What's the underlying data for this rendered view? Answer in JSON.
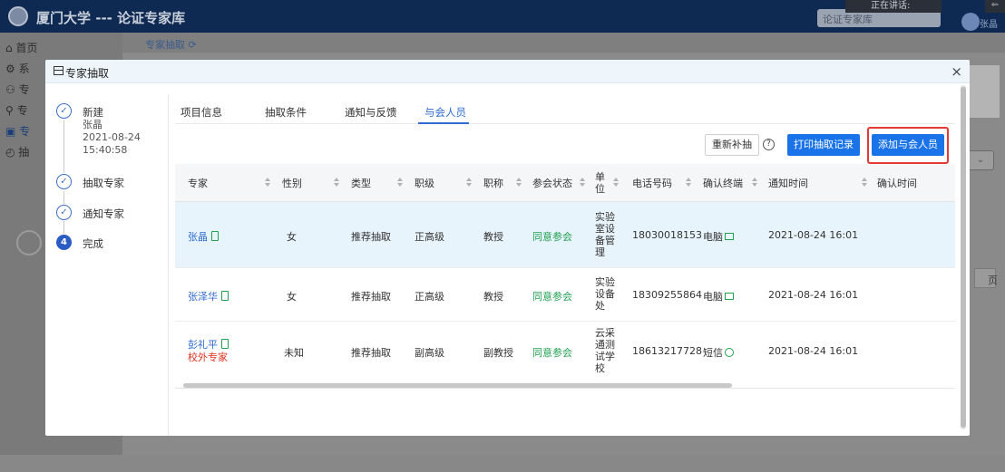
{
  "app": {
    "title": "厦门大学 --- 论证专家库",
    "library_select": "论证专家库",
    "speaking": "正在讲话:",
    "user": "张晶"
  },
  "sidebar": {
    "items": [
      {
        "label": "首页"
      },
      {
        "label": "系"
      },
      {
        "label": "专"
      },
      {
        "label": "专"
      },
      {
        "label": "专"
      },
      {
        "label": "抽"
      }
    ]
  },
  "breadcrumb": {
    "tab": "专家抽取"
  },
  "background": {
    "page_suffix": "页",
    "right_card_text": "F"
  },
  "modal": {
    "title": "专家抽取",
    "close": "×"
  },
  "steps": [
    {
      "label": "新建",
      "who": "张晶",
      "date": "2021-08-24",
      "time": "15:40:58"
    },
    {
      "label": "抽取专家"
    },
    {
      "label": "通知专家"
    },
    {
      "number": "4",
      "label": "完成"
    }
  ],
  "tabs": [
    "项目信息",
    "抽取条件",
    "通知与反馈",
    "与会人员"
  ],
  "toolbar": {
    "resupply": "重新补抽",
    "help": "?",
    "print": "打印抽取记录",
    "add": "添加与会人员"
  },
  "table": {
    "headers": [
      "专家",
      "性别",
      "类型",
      "职级",
      "职称",
      "参会状态",
      "单位",
      "电话号码",
      "确认终端",
      "通知时间",
      "确认时间"
    ],
    "rows": [
      {
        "name": "张晶",
        "external": "",
        "gender": "女",
        "type": "推荐抽取",
        "rank": "正高级",
        "title": "教授",
        "status": "同意参会",
        "dept": "实验室设备管理",
        "phone": "18030018153",
        "terminal": "电脑",
        "terminal_icon": "monitor-icon",
        "notify_time": "2021-08-24 16:01",
        "confirm_time": ""
      },
      {
        "name": "张泽华",
        "external": "",
        "gender": "女",
        "type": "推荐抽取",
        "rank": "正高级",
        "title": "教授",
        "status": "同意参会",
        "dept": "实验设备处",
        "phone": "18309255864",
        "terminal": "电脑",
        "terminal_icon": "monitor-icon",
        "notify_time": "2021-08-24 16:01",
        "confirm_time": ""
      },
      {
        "name": "彭礼平",
        "external": "校外专家",
        "gender": "未知",
        "type": "推荐抽取",
        "rank": "副高级",
        "title": "副教授",
        "status": "同意参会",
        "dept": "云采通测试学校",
        "phone": "18613217728",
        "terminal": "短信",
        "terminal_icon": "sms-icon",
        "notify_time": "2021-08-24 16:01",
        "confirm_time": ""
      }
    ]
  },
  "colors": {
    "primary": "#1a73e8",
    "success": "#20a050",
    "danger": "#e53935",
    "selected_row": "#e8f4fb"
  }
}
